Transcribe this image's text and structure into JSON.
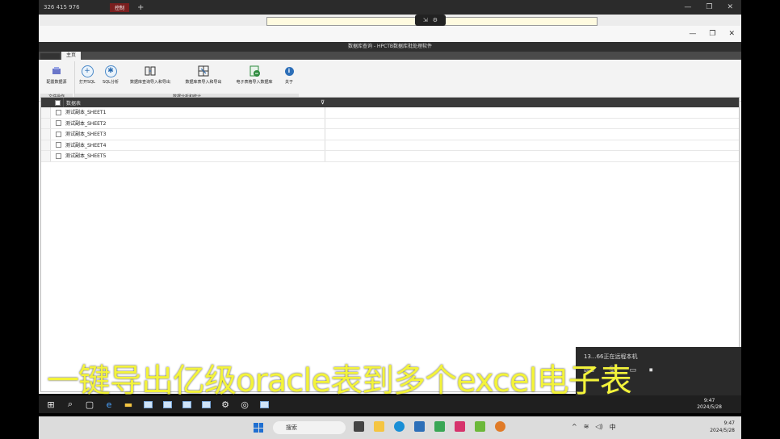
{
  "remote": {
    "session_label": "326 415 976",
    "tab_label": "控制",
    "plus": "+"
  },
  "app": {
    "window_title": "数据库查询 - HPCTB数据库批处理软件",
    "tabs": {
      "home": "主页"
    },
    "ribbon": {
      "groups": [
        {
          "label": "文件操作"
        },
        {
          "label": "数据分析和统计"
        }
      ],
      "buttons": [
        {
          "label": "配置数据源",
          "icon": "database-icon"
        },
        {
          "label": "打开SQL",
          "icon": "plus-circle-icon"
        },
        {
          "label": "SQL分析",
          "icon": "analysis-icon"
        },
        {
          "label": "数据库查询导入和导出",
          "icon": "db-import-icon"
        },
        {
          "label": "数据库表导入和导出",
          "icon": "table-import-icon"
        },
        {
          "label": "电子表格导入数据库",
          "icon": "excel-import-icon"
        },
        {
          "label": "关于",
          "icon": "info-icon"
        }
      ]
    },
    "grid": {
      "column_header": "数据表",
      "rows": [
        "测试副本_SHEET1",
        "测试副本_SHEET2",
        "测试副本_SHEET3",
        "测试副本_SHEET4",
        "测试副本_SHEET5"
      ]
    }
  },
  "popup": {
    "message": "13...66正在远程本机"
  },
  "caption": "一键导出亿级oracle表到多个excel电子表",
  "taskbar_inner": {
    "time": "9:47",
    "date": "2024/5/28",
    "ime": "中"
  },
  "taskbar_outer": {
    "search_placeholder": "搜索",
    "time": "9:47",
    "date": "2024/5/28",
    "ime": "中"
  },
  "colors": {
    "caption": "#f3f33a",
    "dark_header": "#3a3a3a",
    "accent_blue": "#2d6fb8"
  }
}
